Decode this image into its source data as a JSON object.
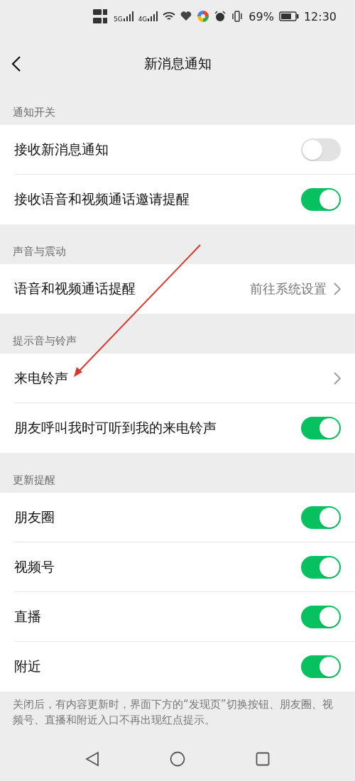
{
  "status_bar": {
    "network_1": "5G",
    "network_2": "4G",
    "battery": "69%",
    "time": "12:30"
  },
  "header": {
    "title": "新消息通知"
  },
  "sections": [
    {
      "title": "通知开关",
      "rows": [
        {
          "kind": "toggle",
          "label": "接收新消息通知",
          "on": false
        },
        {
          "kind": "toggle",
          "label": "接收语音和视频通话邀请提醒",
          "on": true
        }
      ]
    },
    {
      "title": "声音与震动",
      "rows": [
        {
          "kind": "link",
          "label": "语音和视频通话提醒",
          "value": "前往系统设置"
        }
      ]
    },
    {
      "title": "提示音与铃声",
      "rows": [
        {
          "kind": "link",
          "label": "来电铃声"
        },
        {
          "kind": "toggle",
          "label": "朋友呼叫我时可听到我的来电铃声",
          "on": true
        }
      ]
    },
    {
      "title": "更新提醒",
      "rows": [
        {
          "kind": "toggle",
          "label": "朋友圈",
          "on": true
        },
        {
          "kind": "toggle",
          "label": "视频号",
          "on": true
        },
        {
          "kind": "toggle",
          "label": "直播",
          "on": true
        },
        {
          "kind": "toggle",
          "label": "附近",
          "on": true
        }
      ],
      "note": "关闭后，有内容更新时，界面下方的“发现页”切换按钮、朋友圈、视频号、直播和附近入口不再出现红点提示。"
    }
  ]
}
